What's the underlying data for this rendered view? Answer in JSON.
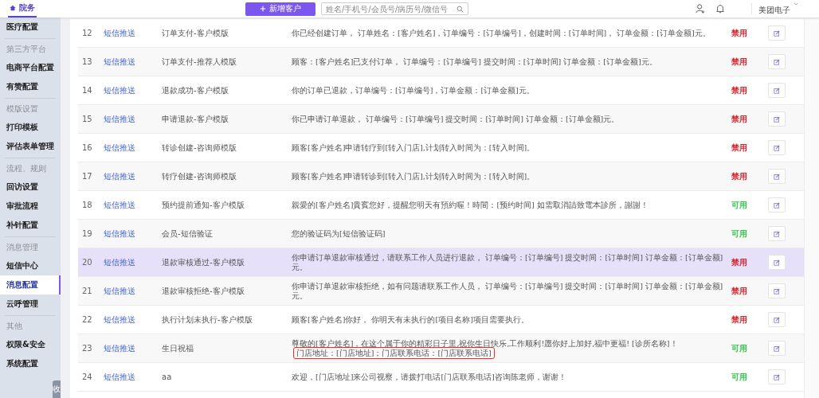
{
  "header": {
    "tab": {
      "label": "院务",
      "selected": true
    },
    "add_button": "新增客户",
    "search": {
      "placeholder": "姓名/手机号/会员号/病历号/微信号"
    },
    "company": "美团电子"
  },
  "sidebar": {
    "items": [
      {
        "kind": "item",
        "label": "医疗配置",
        "selected": false
      },
      {
        "kind": "group",
        "label": "第三方平台"
      },
      {
        "kind": "item",
        "label": "电商平台配置",
        "selected": false
      },
      {
        "kind": "item",
        "label": "有赞配置",
        "selected": false
      },
      {
        "kind": "group",
        "label": "模版设置"
      },
      {
        "kind": "item",
        "label": "打印模板",
        "selected": false
      },
      {
        "kind": "item",
        "label": "评估表单管理",
        "selected": false
      },
      {
        "kind": "group",
        "label": "流程、规则"
      },
      {
        "kind": "item",
        "label": "回访设置",
        "selected": false
      },
      {
        "kind": "item",
        "label": "审批流程",
        "selected": false
      },
      {
        "kind": "item",
        "label": "补针配置",
        "selected": false
      },
      {
        "kind": "group",
        "label": "消息管理"
      },
      {
        "kind": "item",
        "label": "短信中心",
        "selected": false
      },
      {
        "kind": "item",
        "label": "消息配置",
        "selected": true
      },
      {
        "kind": "item",
        "label": "云呼管理",
        "selected": false
      },
      {
        "kind": "group",
        "label": "其他"
      },
      {
        "kind": "item",
        "label": "权限&安全",
        "selected": false
      },
      {
        "kind": "item",
        "label": "系统配置",
        "selected": false
      }
    ],
    "collapse_tab": "收"
  },
  "table": {
    "rows": [
      {
        "no": "12",
        "type": "短信推送",
        "name": "订单支付-客户模版",
        "content": "你已经创建订单， 订单姓名：[客户姓名]，订单编号：[订单编号]，创建时间：[订单时间]， 订单金额：[订单金额]元。",
        "status": {
          "text": "禁用",
          "enabled": false
        },
        "selected": false
      },
      {
        "no": "13",
        "type": "短信推送",
        "name": "订单支付-推荐人模版",
        "content": "顾客：[客户姓名]已支付订单， 订单编号：[订单编号] 提交时间：[订单时间] 订单金额：[订单金额]元。",
        "status": {
          "text": "禁用",
          "enabled": false
        },
        "selected": false
      },
      {
        "no": "14",
        "type": "短信推送",
        "name": "退款成功-客户模版",
        "content": "你的订单已退款，订单编号：[订单编号]，订单金额：[订单金额]元。",
        "status": {
          "text": "禁用",
          "enabled": false
        },
        "selected": false
      },
      {
        "no": "15",
        "type": "短信推送",
        "name": "申请退款-客户模版",
        "content": "你已申请订单退款， 订单编号：[订单编号] 提交时间：[订单时间] 订单金额：[订单金额]元。",
        "status": {
          "text": "禁用",
          "enabled": false
        },
        "selected": false
      },
      {
        "no": "16",
        "type": "短信推送",
        "name": "转诊创建-咨询师模版",
        "content": "顾客[客户姓名]申请转疗到[转入门店],计划转入时间为：[转入时间]。",
        "status": {
          "text": "禁用",
          "enabled": false
        },
        "selected": false
      },
      {
        "no": "17",
        "type": "短信推送",
        "name": "转疗创建-咨询师模版",
        "content": "顾客[客户姓名]申请转诊到[转入门店],计划转入时间为：[转入时间]。",
        "status": {
          "text": "禁用",
          "enabled": false
        },
        "selected": false
      },
      {
        "no": "18",
        "type": "短信推送",
        "name": "预约提前通知-客户模版",
        "content": "親愛的[客户姓名]貴賓您好，提醒您明天有預約喔！時間：[预约时间] 如需取消請致電本診所，謝謝！",
        "status": {
          "text": "可用",
          "enabled": true
        },
        "selected": false
      },
      {
        "no": "19",
        "type": "短信推送",
        "name": "会员-短信验证",
        "content": "您的验证码为[短信验证码]",
        "status": {
          "text": "可用",
          "enabled": true
        },
        "selected": false
      },
      {
        "no": "20",
        "type": "短信推送",
        "name": "退款审核通过-客户模版",
        "content": "你申请订单退款审核通过，请联系工作人员进行退款， 订单编号：[订单编号] 提交时间：[订单时间] 订单金额：[订单金额]元。",
        "status": {
          "text": "禁用",
          "enabled": false
        },
        "selected": true
      },
      {
        "no": "21",
        "type": "短信推送",
        "name": "退款审核拒绝-客户模版",
        "content": "你申请订单退款审核拒绝，如有问题请联系工作人员， 订单编号：[订单编号] 提交时间：[订单时间] 订单金额：[订单金额]元。",
        "status": {
          "text": "禁用",
          "enabled": false
        },
        "selected": false
      },
      {
        "no": "22",
        "type": "短信推送",
        "name": "执行计划未执行-客户模版",
        "content": "顾客[客户姓名]你好， 你明天有未执行的[项目名称]项目需要执行。",
        "status": {
          "text": "禁用",
          "enabled": false
        },
        "selected": false
      },
      {
        "no": "23",
        "type": "短信推送",
        "name": "生日祝福",
        "content": "尊敬的[客户姓名]，在这个属于你的精彩日子里,祝你生日快乐,工作顺利!愿你好上加好,福中更福! [诊所名称]！",
        "highlight": "门店地址：[门店地址]；门店联系电话：[门店联系电话]",
        "status": {
          "text": "可用",
          "enabled": true
        },
        "selected": false
      },
      {
        "no": "24",
        "type": "短信推送",
        "name": "aa",
        "content": "欢迎，[门店地址]来公司视察，请拨打电话[门店联系电话]咨询陈老师，谢谢！",
        "status": {
          "text": "可用",
          "enabled": true
        },
        "selected": false
      }
    ]
  }
}
